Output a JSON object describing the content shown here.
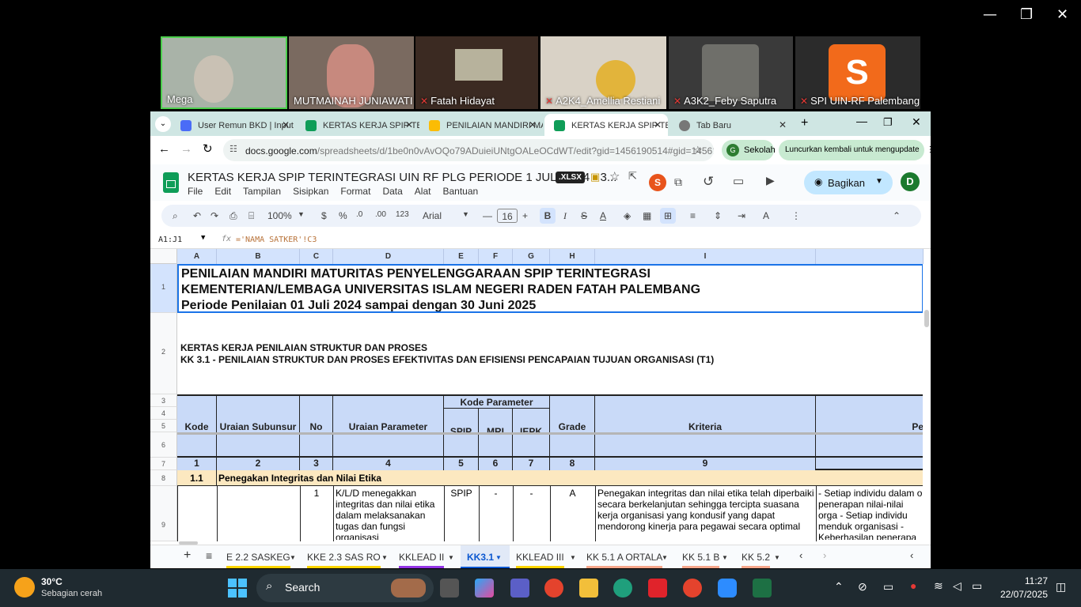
{
  "window_controls": {
    "minimize": "—",
    "restore": "❐",
    "close": "✕"
  },
  "participants": [
    {
      "name": "Mega",
      "muted": false
    },
    {
      "name": "MUTMAINAH JUNIAWATI",
      "muted": false
    },
    {
      "name": "Fatah Hidayat",
      "muted": true
    },
    {
      "name": "A2K4_Amellia Restiani",
      "muted": true
    },
    {
      "name": "A3K2_Feby Saputra",
      "muted": true
    },
    {
      "name": "SPI UIN-RF Palembang",
      "muted": true,
      "avatar_letter": "S"
    }
  ],
  "browser": {
    "tabs": [
      {
        "label": "User Remun BKD | Input",
        "icon_color": "#4a6cf7"
      },
      {
        "label": "KERTAS KERJA SPIP TERINT",
        "icon_color": "#0f9d58"
      },
      {
        "label": "PENILAIAN MANDIRI MA",
        "icon_color": "#fbbc04"
      },
      {
        "label": "KERTAS KERJA SPIP TERIN",
        "icon_color": "#0f9d58",
        "active": true
      },
      {
        "label": "Tab Baru",
        "icon_color": "#555"
      }
    ],
    "new_tab": "+",
    "url_domain": "docs.google.com",
    "url_path": "/spreadsheets/d/1be0n0vAvOQo79ADuieiUNtgOALeOCdWT/edit?gid=1456190514#gid=1456190...",
    "profile_label": "Sekolah",
    "profile_letter": "G",
    "relaunch_label": "Luncurkan kembali untuk mengupdate"
  },
  "doc": {
    "title": "KERTAS KERJA SPIP TERINTEGRASI UIN RF PLG PERIODE 1 JULI 2024 - 3...",
    "badge": ".XLSX",
    "menus": [
      "File",
      "Edit",
      "Tampilan",
      "Sisipkan",
      "Format",
      "Data",
      "Alat",
      "Bantuan"
    ],
    "share_label": "Bagikan",
    "user_letter": "D",
    "collab_letter": "S"
  },
  "toolbar": {
    "zoom": "100%",
    "currency": "$",
    "percent": "%",
    "dec_less": ".0",
    "dec_more": ".00",
    "num_format": "123",
    "font": "Arial",
    "font_size": "16"
  },
  "formula": {
    "name_box": "A1:J1",
    "fx": "fx",
    "text": "='NAMA SATKER'!C3"
  },
  "columns": [
    "A",
    "B",
    "C",
    "D",
    "E",
    "F",
    "G",
    "H",
    "I"
  ],
  "rows": [
    "1",
    "2",
    "3",
    "4",
    "5",
    "6",
    "7",
    "8",
    "9"
  ],
  "sheet": {
    "r1_line1": "PENILAIAN MANDIRI MATURITAS PENYELENGGARAAN SPIP TERINTEGRASI",
    "r1_line2": "KEMENTERIAN/LEMBAGA UNIVERSITAS ISLAM NEGERI RADEN FATAH PALEMBANG",
    "r1_line3": "Periode Penilaian 01 Juli 2024 sampai dengan 30 Juni 2025",
    "r2_line1": "KERTAS KERJA PENILAIAN STRUKTUR DAN PROSES",
    "r2_line2": "KK 3.1 - PENILAIAN STRUKTUR DAN PROSES EFEKTIVITAS DAN EFISIENSI PENCAPAIAN TUJUAN ORGANISASI (T1)",
    "headers": {
      "kode": "Kode",
      "uraian_subunsur": "Uraian Subunsur",
      "no": "No",
      "uraian_parameter": "Uraian Parameter",
      "kode_parameter": "Kode Parameter",
      "spip": "SPIP",
      "mri": "MRI",
      "iepk": "IEPK",
      "grade": "Grade",
      "kriteria": "Kriteria",
      "pe": "Pe"
    },
    "numbers": [
      "1",
      "2",
      "3",
      "4",
      "5",
      "6",
      "7",
      "8",
      "9"
    ],
    "row8": {
      "kode": "1.1",
      "label": "Penegakan Integritas dan Nilai Etika"
    },
    "row9": {
      "no": "1",
      "param": "K/L/D menegakkan integritas dan nilai etika dalam melaksanakan tugas dan fungsi organisasi",
      "spip": "SPIP",
      "mri": "-",
      "iepk": "-",
      "grade": "A",
      "kriteria": "Penegakan integritas dan nilai etika telah diperbaiki secara berkelanjutan sehingga tercipta suasana kerja organisasi yang kondusif yang dapat mendorong kinerja para pegawai secara optimal",
      "next": "- Setiap individu dalam o penerapan nilai-nilai orga - Setiap individu menduk organisasi - Keberhasilan penerapa"
    }
  },
  "sheet_tabs": [
    "E 2.2 SASKEG",
    "KKE 2.3 SAS RO",
    "KKLEAD II",
    "KK3.1",
    "KKLEAD III",
    "KK 5.1 A ORTALA",
    "KK 5.1 B",
    "KK 5.2"
  ],
  "active_sheet": "KK3.1",
  "taskbar": {
    "weather_temp": "30°C",
    "weather_desc": "Sebagian cerah",
    "search": "Search",
    "time": "11:27",
    "date": "22/07/2025"
  }
}
